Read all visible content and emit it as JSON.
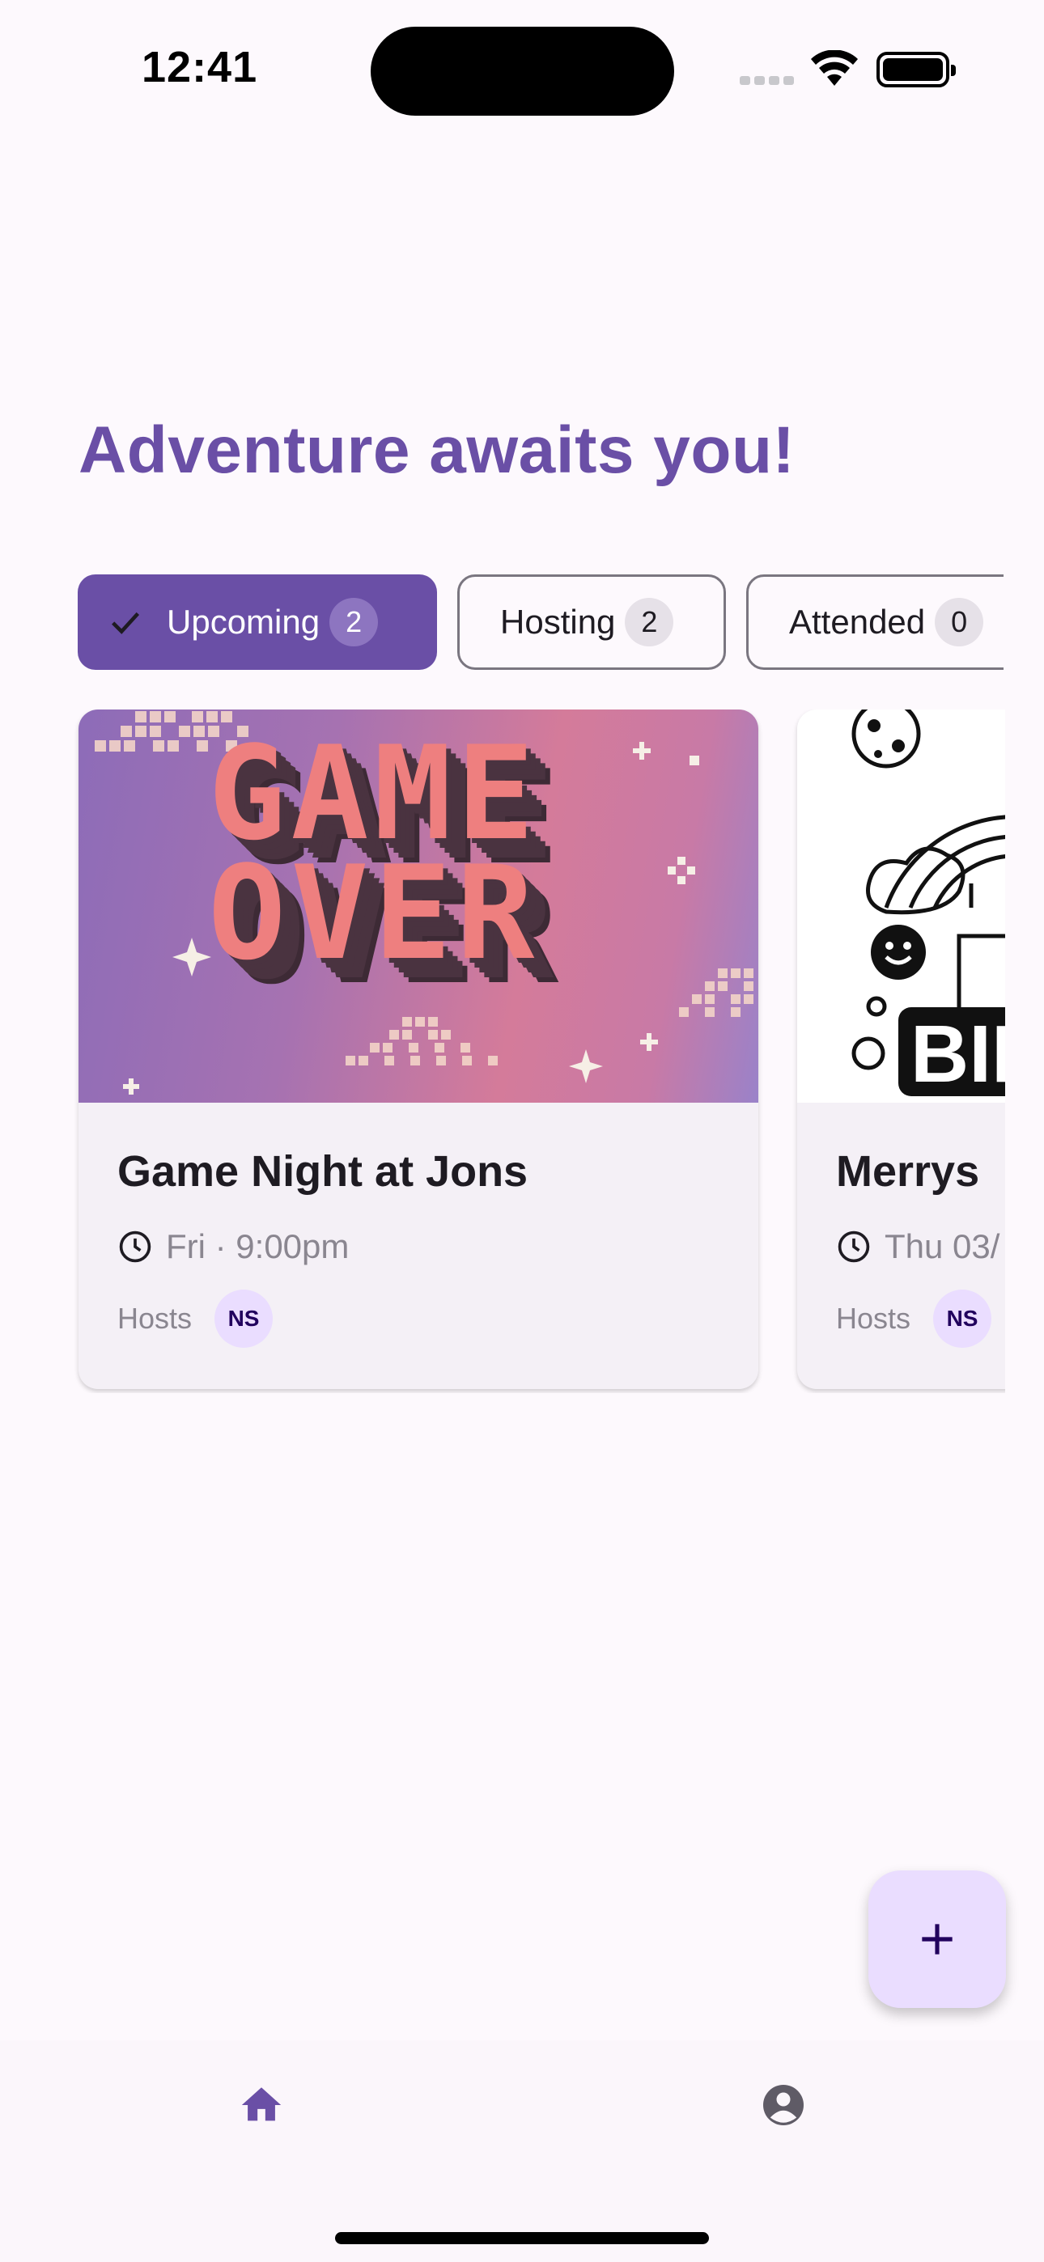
{
  "status_bar": {
    "time": "12:41"
  },
  "headline": "Adventure awaits you!",
  "filters": [
    {
      "label": "Upcoming",
      "count": "2",
      "selected": true
    },
    {
      "label": "Hosting",
      "count": "2",
      "selected": false
    },
    {
      "label": "Attended",
      "count": "0",
      "selected": false
    }
  ],
  "events": [
    {
      "title": "Game Night at Jons",
      "when": "Fri · 9:00pm",
      "hosts_label": "Hosts",
      "host_initials": "NS",
      "image_text": "GAME OVER"
    },
    {
      "title": "Merrys",
      "when": "Thu 03/",
      "hosts_label": "Hosts",
      "host_initials": "NS",
      "image_text": "BIR"
    }
  ],
  "fab": {
    "icon": "plus-icon"
  },
  "nav": [
    {
      "icon": "home-icon",
      "active": true
    },
    {
      "icon": "account-circle-icon",
      "active": false
    }
  ],
  "colors": {
    "primary": "#6a4fa6",
    "fab_bg": "#eaddff",
    "background": "#fdf9fd"
  }
}
